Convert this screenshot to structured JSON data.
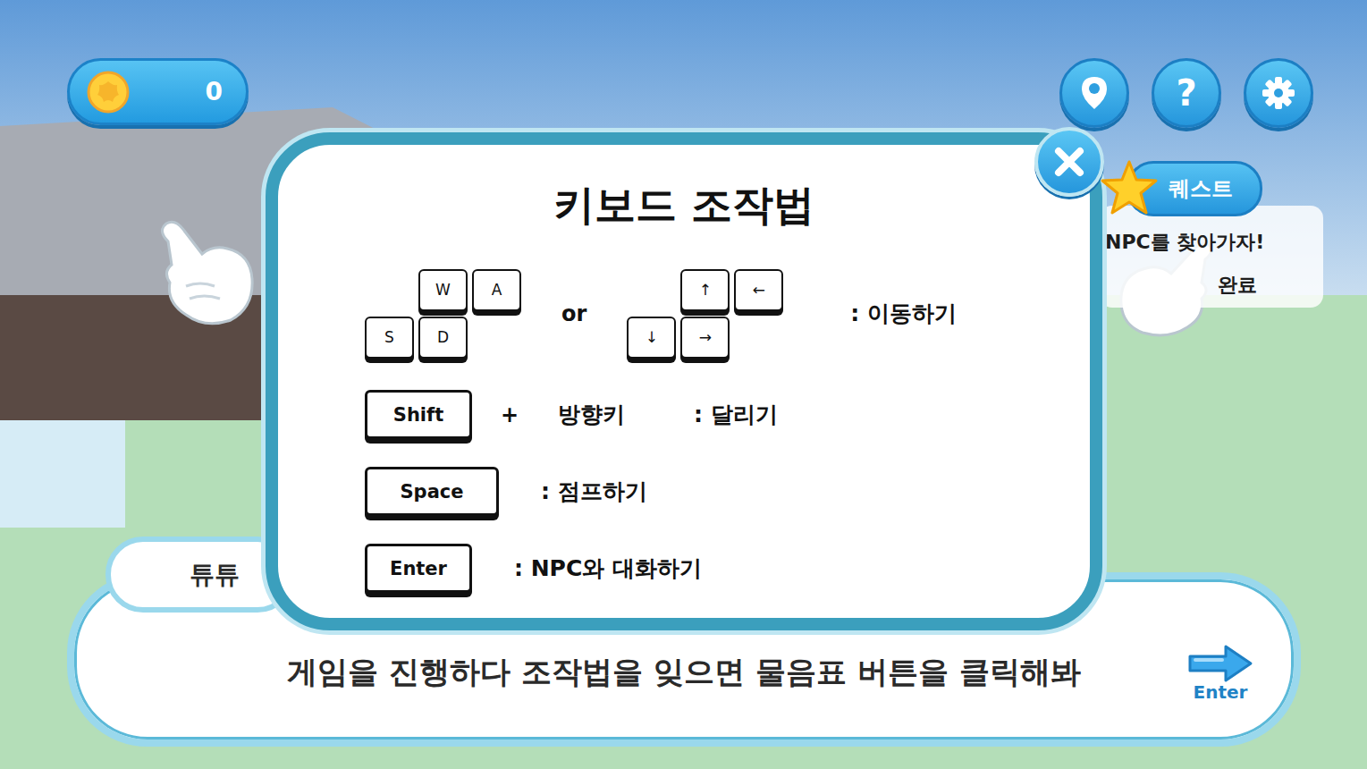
{
  "hud": {
    "coins": "0",
    "help_button": "?"
  },
  "quest": {
    "title": "퀘스트",
    "task": "NPC를 찾아가자!",
    "status": "완료"
  },
  "controls_modal": {
    "title": "키보드 조작법",
    "move_row": {
      "groups": [
        {
          "top": "W",
          "bottom": [
            "A",
            "S",
            "D"
          ]
        },
        {
          "top": "↑",
          "bottom": [
            "←",
            "↓",
            "→"
          ]
        }
      ],
      "separator": "or",
      "action": ": 이동하기"
    },
    "key_rows": [
      {
        "kind": "combo",
        "key": "Shift",
        "plus": "+",
        "target": "방향키",
        "action": ": 달리기"
      },
      {
        "kind": "single",
        "key": "Space",
        "plus": "",
        "target": "",
        "action": ": 점프하기"
      },
      {
        "kind": "single",
        "key": "Enter",
        "plus": "",
        "target": "",
        "action": ": NPC와 대화하기"
      }
    ]
  },
  "dialog": {
    "speaker": "튜튜",
    "text": "게임을 진행하다 조작법을 잊으면 물음표 버튼을 클릭해봐",
    "next_label": "Enter"
  }
}
